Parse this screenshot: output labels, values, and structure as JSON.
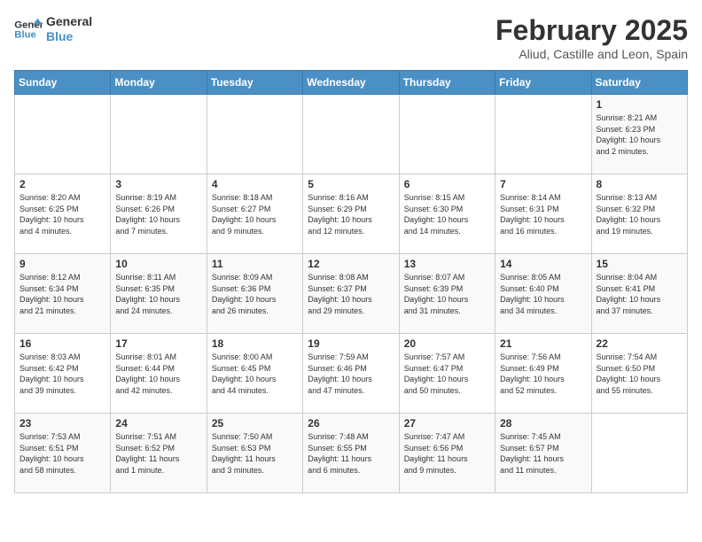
{
  "logo": {
    "line1": "General",
    "line2": "Blue"
  },
  "title": "February 2025",
  "subtitle": "Aliud, Castille and Leon, Spain",
  "days_of_week": [
    "Sunday",
    "Monday",
    "Tuesday",
    "Wednesday",
    "Thursday",
    "Friday",
    "Saturday"
  ],
  "weeks": [
    [
      {
        "day": "",
        "info": ""
      },
      {
        "day": "",
        "info": ""
      },
      {
        "day": "",
        "info": ""
      },
      {
        "day": "",
        "info": ""
      },
      {
        "day": "",
        "info": ""
      },
      {
        "day": "",
        "info": ""
      },
      {
        "day": "1",
        "info": "Sunrise: 8:21 AM\nSunset: 6:23 PM\nDaylight: 10 hours\nand 2 minutes."
      }
    ],
    [
      {
        "day": "2",
        "info": "Sunrise: 8:20 AM\nSunset: 6:25 PM\nDaylight: 10 hours\nand 4 minutes."
      },
      {
        "day": "3",
        "info": "Sunrise: 8:19 AM\nSunset: 6:26 PM\nDaylight: 10 hours\nand 7 minutes."
      },
      {
        "day": "4",
        "info": "Sunrise: 8:18 AM\nSunset: 6:27 PM\nDaylight: 10 hours\nand 9 minutes."
      },
      {
        "day": "5",
        "info": "Sunrise: 8:16 AM\nSunset: 6:29 PM\nDaylight: 10 hours\nand 12 minutes."
      },
      {
        "day": "6",
        "info": "Sunrise: 8:15 AM\nSunset: 6:30 PM\nDaylight: 10 hours\nand 14 minutes."
      },
      {
        "day": "7",
        "info": "Sunrise: 8:14 AM\nSunset: 6:31 PM\nDaylight: 10 hours\nand 16 minutes."
      },
      {
        "day": "8",
        "info": "Sunrise: 8:13 AM\nSunset: 6:32 PM\nDaylight: 10 hours\nand 19 minutes."
      }
    ],
    [
      {
        "day": "9",
        "info": "Sunrise: 8:12 AM\nSunset: 6:34 PM\nDaylight: 10 hours\nand 21 minutes."
      },
      {
        "day": "10",
        "info": "Sunrise: 8:11 AM\nSunset: 6:35 PM\nDaylight: 10 hours\nand 24 minutes."
      },
      {
        "day": "11",
        "info": "Sunrise: 8:09 AM\nSunset: 6:36 PM\nDaylight: 10 hours\nand 26 minutes."
      },
      {
        "day": "12",
        "info": "Sunrise: 8:08 AM\nSunset: 6:37 PM\nDaylight: 10 hours\nand 29 minutes."
      },
      {
        "day": "13",
        "info": "Sunrise: 8:07 AM\nSunset: 6:39 PM\nDaylight: 10 hours\nand 31 minutes."
      },
      {
        "day": "14",
        "info": "Sunrise: 8:05 AM\nSunset: 6:40 PM\nDaylight: 10 hours\nand 34 minutes."
      },
      {
        "day": "15",
        "info": "Sunrise: 8:04 AM\nSunset: 6:41 PM\nDaylight: 10 hours\nand 37 minutes."
      }
    ],
    [
      {
        "day": "16",
        "info": "Sunrise: 8:03 AM\nSunset: 6:42 PM\nDaylight: 10 hours\nand 39 minutes."
      },
      {
        "day": "17",
        "info": "Sunrise: 8:01 AM\nSunset: 6:44 PM\nDaylight: 10 hours\nand 42 minutes."
      },
      {
        "day": "18",
        "info": "Sunrise: 8:00 AM\nSunset: 6:45 PM\nDaylight: 10 hours\nand 44 minutes."
      },
      {
        "day": "19",
        "info": "Sunrise: 7:59 AM\nSunset: 6:46 PM\nDaylight: 10 hours\nand 47 minutes."
      },
      {
        "day": "20",
        "info": "Sunrise: 7:57 AM\nSunset: 6:47 PM\nDaylight: 10 hours\nand 50 minutes."
      },
      {
        "day": "21",
        "info": "Sunrise: 7:56 AM\nSunset: 6:49 PM\nDaylight: 10 hours\nand 52 minutes."
      },
      {
        "day": "22",
        "info": "Sunrise: 7:54 AM\nSunset: 6:50 PM\nDaylight: 10 hours\nand 55 minutes."
      }
    ],
    [
      {
        "day": "23",
        "info": "Sunrise: 7:53 AM\nSunset: 6:51 PM\nDaylight: 10 hours\nand 58 minutes."
      },
      {
        "day": "24",
        "info": "Sunrise: 7:51 AM\nSunset: 6:52 PM\nDaylight: 11 hours\nand 1 minute."
      },
      {
        "day": "25",
        "info": "Sunrise: 7:50 AM\nSunset: 6:53 PM\nDaylight: 11 hours\nand 3 minutes."
      },
      {
        "day": "26",
        "info": "Sunrise: 7:48 AM\nSunset: 6:55 PM\nDaylight: 11 hours\nand 6 minutes."
      },
      {
        "day": "27",
        "info": "Sunrise: 7:47 AM\nSunset: 6:56 PM\nDaylight: 11 hours\nand 9 minutes."
      },
      {
        "day": "28",
        "info": "Sunrise: 7:45 AM\nSunset: 6:57 PM\nDaylight: 11 hours\nand 11 minutes."
      },
      {
        "day": "",
        "info": ""
      }
    ]
  ]
}
